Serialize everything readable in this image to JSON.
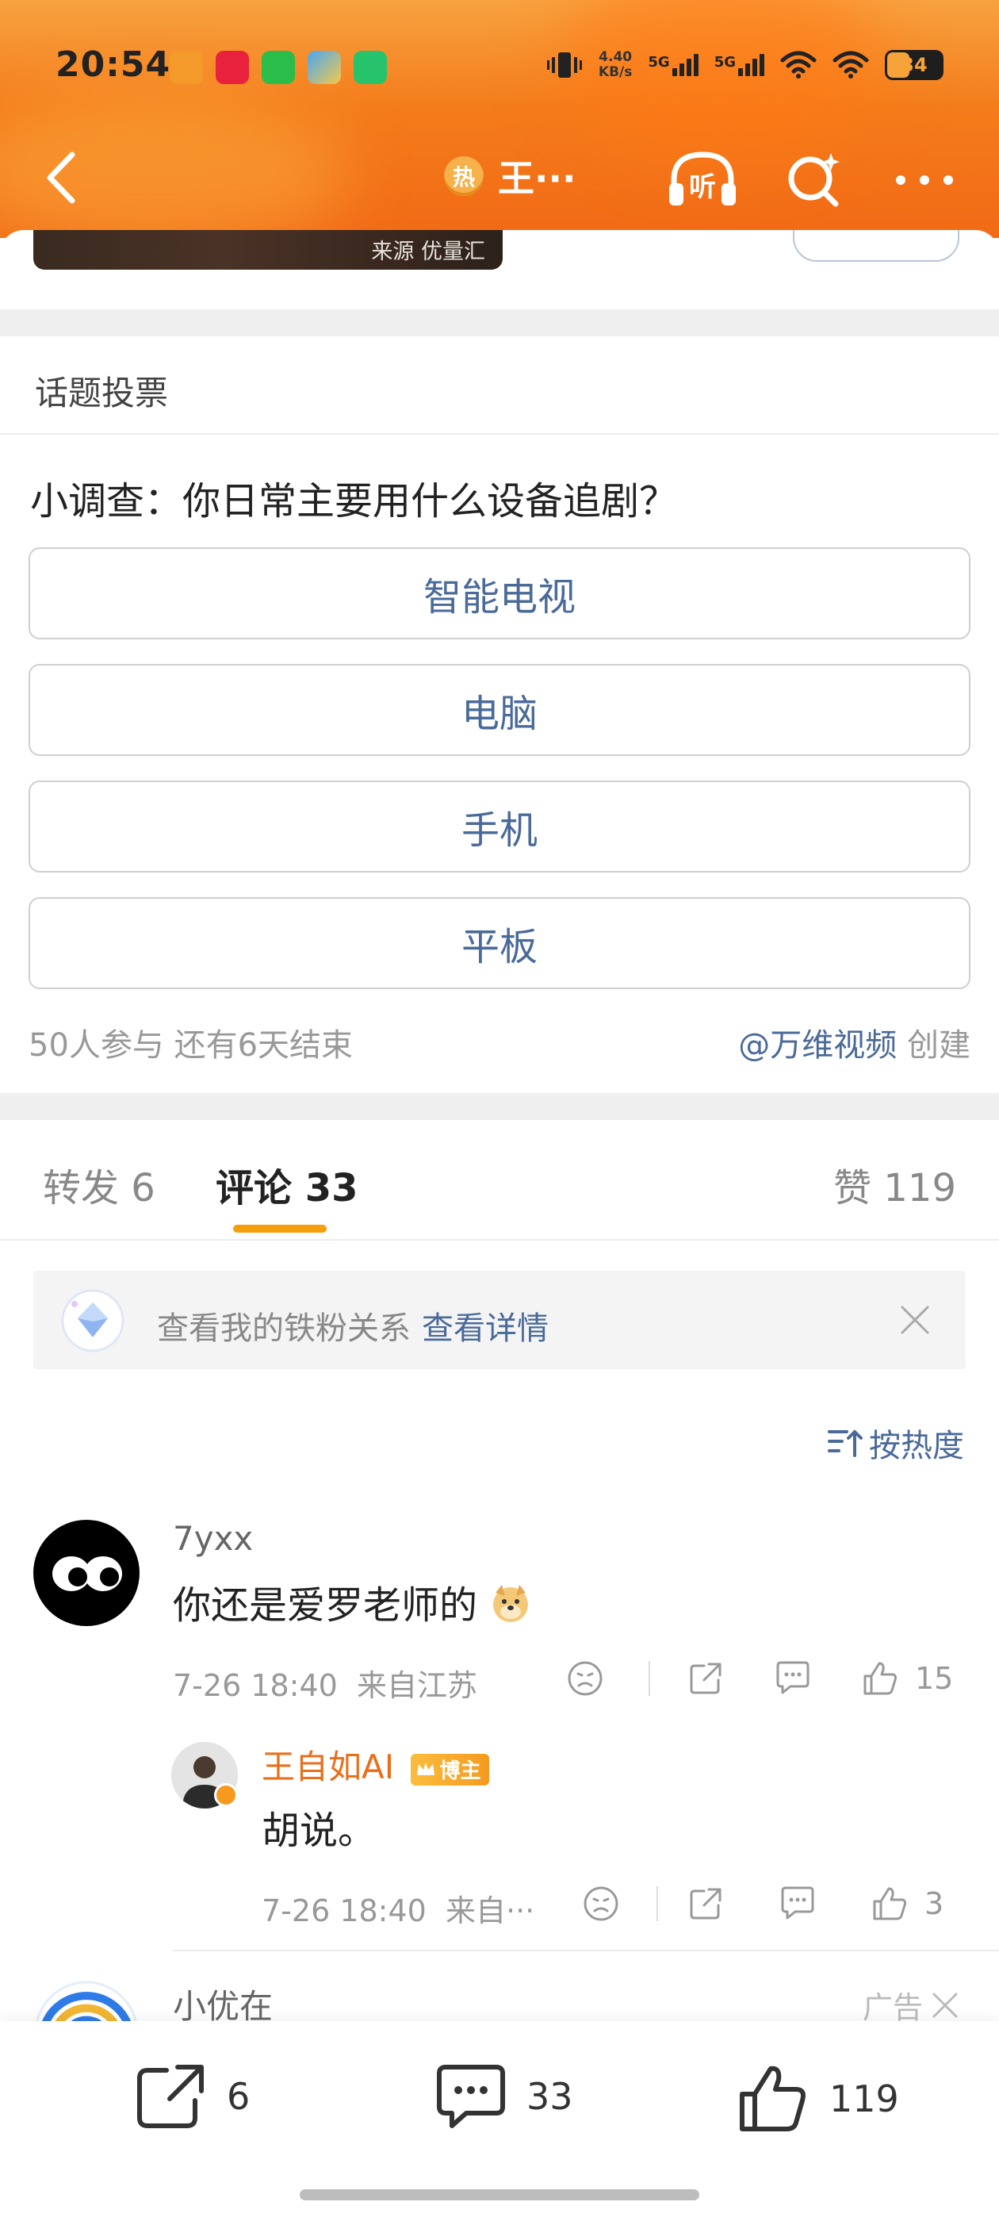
{
  "status_bar": {
    "time": "20:54",
    "net_speed_value": "4.40",
    "net_speed_unit": "KB/s",
    "sig1_label": "5G",
    "sig2_label": "5G",
    "battery": "34"
  },
  "nav": {
    "hot_badge": "热",
    "title": "王···"
  },
  "media": {
    "source": "来源 优量汇"
  },
  "poll": {
    "header": "话题投票",
    "question": "小调查：你日常主要用什么设备追剧？",
    "options": [
      "智能电视",
      "电脑",
      "手机",
      "平板"
    ],
    "meta": "50人参与  还有6天结束",
    "creator_user": "@万维视频",
    "creator_suffix": " 创建"
  },
  "tabs": {
    "repost": "转发 6",
    "comments": "评论 33",
    "likes": "赞 119"
  },
  "fan_banner": {
    "text": "查看我的铁粉关系",
    "link": "查看详情"
  },
  "sort": {
    "label": "按热度"
  },
  "comments": [
    {
      "user": "7yxx",
      "text": "你还是爱罗老师的",
      "time": "7-26 18:40",
      "location": "来自江苏",
      "likes": "15"
    }
  ],
  "reply": {
    "user": "王自如AI",
    "badge": "博主",
    "text": "胡说。",
    "time": "7-26 18:40",
    "location": "来自···",
    "likes": "3"
  },
  "ad": {
    "user": "小优在_",
    "label": "广告"
  },
  "bottom_bar": {
    "repost_count": "6",
    "comment_count": "33",
    "like_count": "119"
  }
}
